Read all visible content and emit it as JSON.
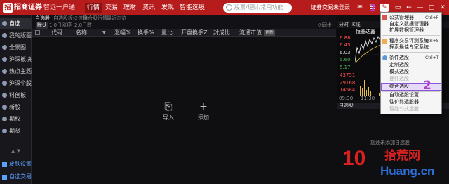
{
  "titlebar": {
    "logo_mark": "招",
    "logo_text": "招商证券",
    "logo_sub": "智远一户通",
    "menu": [
      "行情",
      "交易",
      "理财",
      "资讯",
      "发现",
      "智能选股"
    ],
    "search_placeholder": "股票/理财/常用功能",
    "login_text": "证券交易未登录",
    "icons": [
      "mail-icon",
      "menu-icon",
      "minimize-icon",
      "restore-icon",
      "back-icon",
      "maximize-icon",
      "close-icon"
    ]
  },
  "sidebar": {
    "items": [
      "自选",
      "我的版面",
      "全景图",
      "沪深板块",
      "热点主题",
      "沪深个股",
      "科创板",
      "新股",
      "期权",
      "期货"
    ],
    "collapse_label": "▲ ▼",
    "bottom": [
      "皮肤设置",
      "自选交易"
    ]
  },
  "tabs": {
    "row1": [
      "自选股",
      "自选股板块信息",
      "持仓股行情",
      "最近浏览"
    ],
    "row2": [
      "默认",
      "1.0日涨停",
      "2.0日跌"
    ]
  },
  "table": {
    "columns": [
      "代码",
      "名称",
      "涨幅%",
      "换手%",
      "量比",
      "开盘换手Z",
      "封成比",
      "流通市值"
    ],
    "col_tag": "更新"
  },
  "main_actions": {
    "import_label": "导入",
    "add_label": "添加"
  },
  "right_panel": {
    "tabs": [
      "分时",
      "K线"
    ],
    "stock_title": "恒基达鑫",
    "prices": [
      "6.88",
      "6.45",
      "6.03",
      "5.60",
      "5.17"
    ],
    "volumes": [
      "43751",
      "29168",
      "14584"
    ],
    "times": [
      "09:30",
      "11:30"
    ],
    "watchlist_header": "自选股",
    "watchlist_empty": "您还未添加自选股"
  },
  "dropdown": {
    "items": [
      {
        "label": "公式管理器",
        "shortcut": "Ctrl+F",
        "enabled": true
      },
      {
        "label": "自定义数据管理器",
        "shortcut": "",
        "enabled": true
      },
      {
        "label": "扩展数据管理器",
        "shortcut": "",
        "enabled": true
      },
      {
        "label": "程序交易评测系统",
        "shortcut": "Ctrl+S",
        "enabled": true
      },
      {
        "label": "探索最佳专家系统",
        "shortcut": "",
        "enabled": true
      },
      {
        "label": "条件选股",
        "shortcut": "Ctrl+T",
        "enabled": true
      },
      {
        "label": "定制选股",
        "shortcut": "",
        "enabled": true
      },
      {
        "label": "模式选股",
        "shortcut": "",
        "enabled": true
      },
      {
        "label": "插件选股",
        "shortcut": "",
        "enabled": false
      },
      {
        "label": "综合选股",
        "shortcut": "",
        "enabled": true
      },
      {
        "label": "自动选股设置...",
        "shortcut": "",
        "enabled": true
      },
      {
        "label": "性价比选股器",
        "shortcut": "",
        "enabled": true
      },
      {
        "label": "智能公式选股",
        "shortcut": "",
        "enabled": false
      }
    ]
  },
  "annotations": {
    "step1": "1",
    "step2": "2"
  },
  "watermark": {
    "big": "10",
    "cn": "拾荒网",
    "url": "Huang.cn",
    "color_red": "#d82020",
    "color_blue": "#2d6fd6"
  },
  "colors": {
    "titlebar": "#b71c1c",
    "background": "#0f0f12",
    "highlight_border": "#8a55d8",
    "annotation": "#b040d0"
  }
}
